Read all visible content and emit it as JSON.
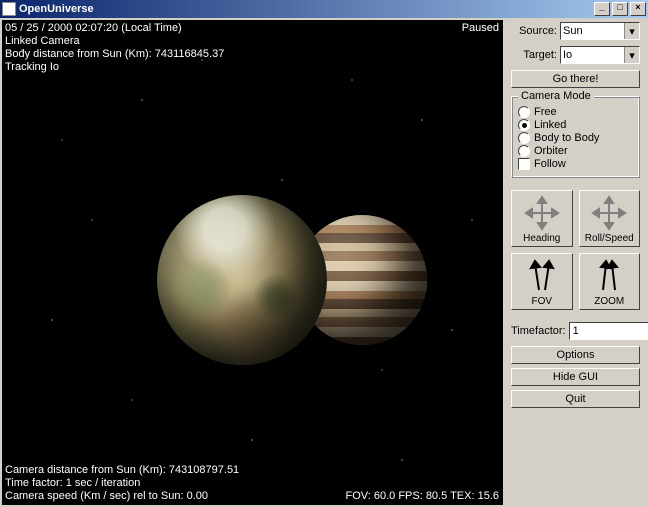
{
  "window": {
    "title": "OpenUniverse"
  },
  "overlay": {
    "datetime": "05 / 25 / 2000  02:07:20 (Local Time)",
    "camera_mode_line": "Linked Camera",
    "body_distance": "Body distance from Sun (Km): 743116845.37",
    "tracking": "Tracking Io",
    "paused": "Paused",
    "cam_distance": "Camera distance from Sun (Km): 743108797.51",
    "timefactor_line": "Time factor: 1 sec / iteration",
    "cam_speed": "Camera speed (Km / sec) rel to Sun: 0.00",
    "stats": "FOV: 60.0   FPS: 80.5  TEX: 15.6"
  },
  "panel": {
    "source_label": "Source:",
    "source_value": "Sun",
    "target_label": "Target:",
    "target_value": "Io",
    "go_there": "Go there!",
    "camera_mode_legend": "Camera Mode",
    "modes": {
      "free": "Free",
      "linked": "Linked",
      "body2body": "Body to Body",
      "orbiter": "Orbiter",
      "follow": "Follow"
    },
    "nav": {
      "heading": "Heading",
      "rollspeed": "Roll/Speed",
      "fov": "FOV",
      "zoom": "ZOOM"
    },
    "timefactor_label": "Timefactor:",
    "timefactor_value": "1",
    "options": "Options",
    "hide_gui": "Hide GUI",
    "quit": "Quit"
  }
}
